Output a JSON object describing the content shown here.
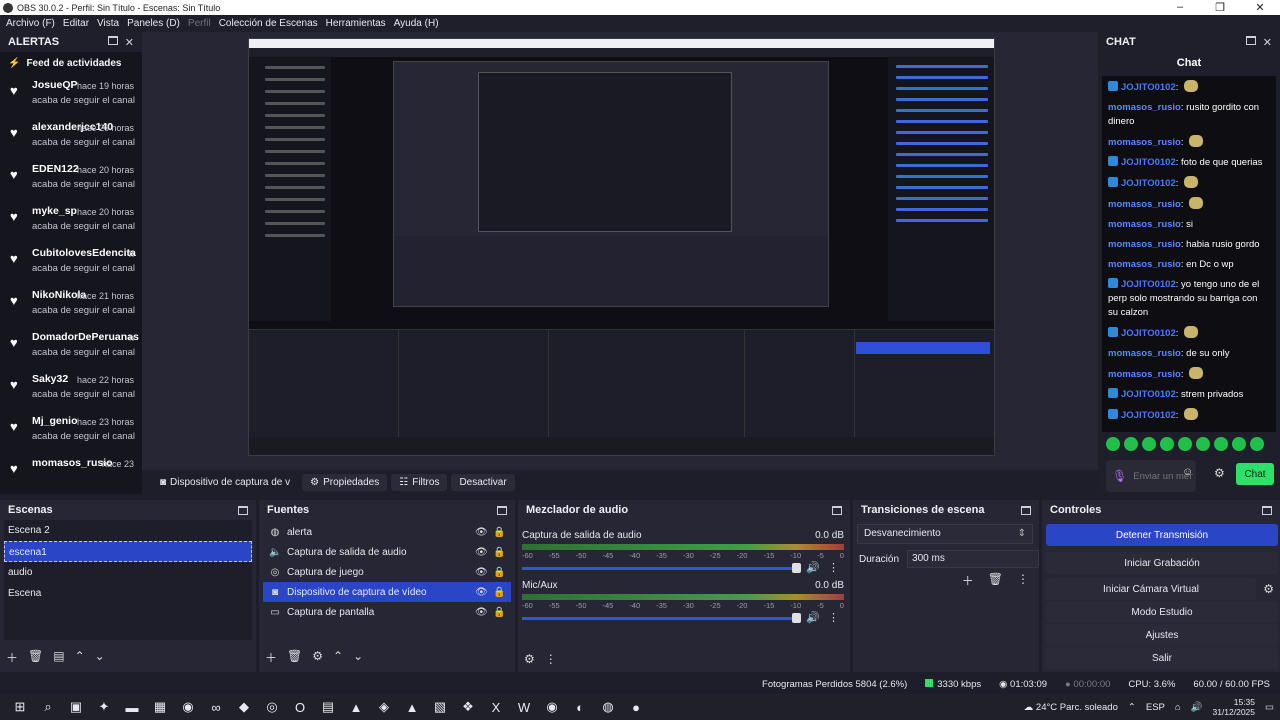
{
  "window": {
    "title": "OBS 30.0.2 - Perfil: Sin Título - Escenas: Sin Título"
  },
  "menu": [
    "Archivo (F)",
    "Editar",
    "Vista",
    "Paneles (D)",
    "Perfil",
    "Colección de Escenas",
    "Herramientas",
    "Ayuda (H)"
  ],
  "alerts": {
    "dock_title": "ALERTAS",
    "feed_title": "Feed de actividades",
    "items": [
      {
        "user": "JosueQP",
        "time": "hace 19 horas",
        "action": "acaba de seguir el canal"
      },
      {
        "user": "alexanderjcc140",
        "time": "hace 20 horas",
        "action": "acaba de seguir el canal"
      },
      {
        "user": "EDEN122",
        "time": "hace 20 horas",
        "action": "acaba de seguir el canal"
      },
      {
        "user": "myke_sp",
        "time": "hace 20 horas",
        "action": "acaba de seguir el canal"
      },
      {
        "user": "CubitolovesEdencita",
        "time": "h",
        "action": "acaba de seguir el canal"
      },
      {
        "user": "NikoNikola",
        "time": "hace 21 horas",
        "action": "acaba de seguir el canal"
      },
      {
        "user": "DomadorDePeruanas",
        "time": "h",
        "action": "acaba de seguir el canal"
      },
      {
        "user": "Saky32",
        "time": "hace 22 horas",
        "action": "acaba de seguir el canal"
      },
      {
        "user": "Mj_genio",
        "time": "hace 23 horas",
        "action": "acaba de seguir el canal"
      },
      {
        "user": "momasos_rusio",
        "time": "hace 23",
        "action": ""
      }
    ]
  },
  "source_toolbar": {
    "source": "Dispositivo de captura de v",
    "properties": "Propiedades",
    "filters": "Filtros",
    "deactivate": "Desactivar"
  },
  "chat": {
    "dock_title": "CHAT",
    "title": "Chat",
    "messages": [
      {
        "user": "JOJITO0102",
        "text": "",
        "kind": "a"
      },
      {
        "user": "momasos_rusio",
        "text": "rusito gordito con dinero",
        "kind": "b"
      },
      {
        "user": "momasos_rusio",
        "text": "",
        "kind": "b"
      },
      {
        "user": "JOJITO0102",
        "text": "foto de que querias",
        "kind": "a"
      },
      {
        "user": "JOJITO0102",
        "text": "",
        "kind": "a"
      },
      {
        "user": "momasos_rusio",
        "text": "",
        "kind": "b"
      },
      {
        "user": "momasos_rusio",
        "text": "si",
        "kind": "b"
      },
      {
        "user": "momasos_rusio",
        "text": "habia rusio gordo",
        "kind": "b"
      },
      {
        "user": "momasos_rusio",
        "text": "en Dc o wp",
        "kind": "b"
      },
      {
        "user": "JOJITO0102",
        "text": "yo tengo uno de el perp solo mostrando su barriga con su calzon",
        "kind": "a"
      },
      {
        "user": "JOJITO0102",
        "text": "",
        "kind": "a"
      },
      {
        "user": "momasos_rusio",
        "text": "de su only",
        "kind": "b"
      },
      {
        "user": "momasos_rusio",
        "text": "",
        "kind": "b"
      },
      {
        "user": "JOJITO0102",
        "text": "strem privados",
        "kind": "a"
      },
      {
        "user": "JOJITO0102",
        "text": "",
        "kind": "a"
      }
    ],
    "input_placeholder": "Enviar un mensaje",
    "send_label": "Chat"
  },
  "scenes": {
    "title": "Escenas",
    "items": [
      "Escena 2",
      "escena1",
      "audio",
      "Escena"
    ],
    "selected": 1
  },
  "sources": {
    "title": "Fuentes",
    "items": [
      {
        "name": "alerta",
        "icon": "globe-icon"
      },
      {
        "name": "Captura de salida de audio",
        "icon": "speaker-icon"
      },
      {
        "name": "Captura de juego",
        "icon": "gamepad-icon"
      },
      {
        "name": "Dispositivo de captura de vídeo",
        "icon": "camera-icon"
      },
      {
        "name": "Captura de pantalla",
        "icon": "monitor-icon"
      }
    ],
    "selected": 3
  },
  "mixer": {
    "title": "Mezclador de audio",
    "channels": [
      {
        "name": "Captura de salida de audio",
        "db": "0.0 dB"
      },
      {
        "name": "Mic/Aux",
        "db": "0.0 dB"
      }
    ],
    "ticks": [
      "-60",
      "-55",
      "-50",
      "-45",
      "-40",
      "-35",
      "-30",
      "-25",
      "-20",
      "-15",
      "-10",
      "-5",
      "0"
    ]
  },
  "transitions": {
    "title": "Transiciones de escena",
    "selected": "Desvanecimiento",
    "duration_label": "Duración",
    "duration_value": "300 ms"
  },
  "controls": {
    "title": "Controles",
    "buttons": [
      "Detener Transmisión",
      "Iniciar Grabación",
      "Iniciar Cámara Virtual",
      "Modo Estudio",
      "Ajustes",
      "Salir"
    ]
  },
  "status": {
    "dropped": "Fotogramas Perdidos 5804 (2.6%)",
    "bitrate": "3330 kbps",
    "stream_time": "01:03:09",
    "rec_time": "00:00:00",
    "cpu": "CPU: 3.6%",
    "fps": "60.00 / 60.00 FPS"
  },
  "taskbar": {
    "weather": "24°C  Parc. soleado",
    "lang": "ESP",
    "time": "15:35",
    "date": "31/12/2025"
  },
  "colors": {
    "accent": "#2a46c6",
    "chat_send": "#2ee06a",
    "chat_user": "#4a78ff"
  }
}
